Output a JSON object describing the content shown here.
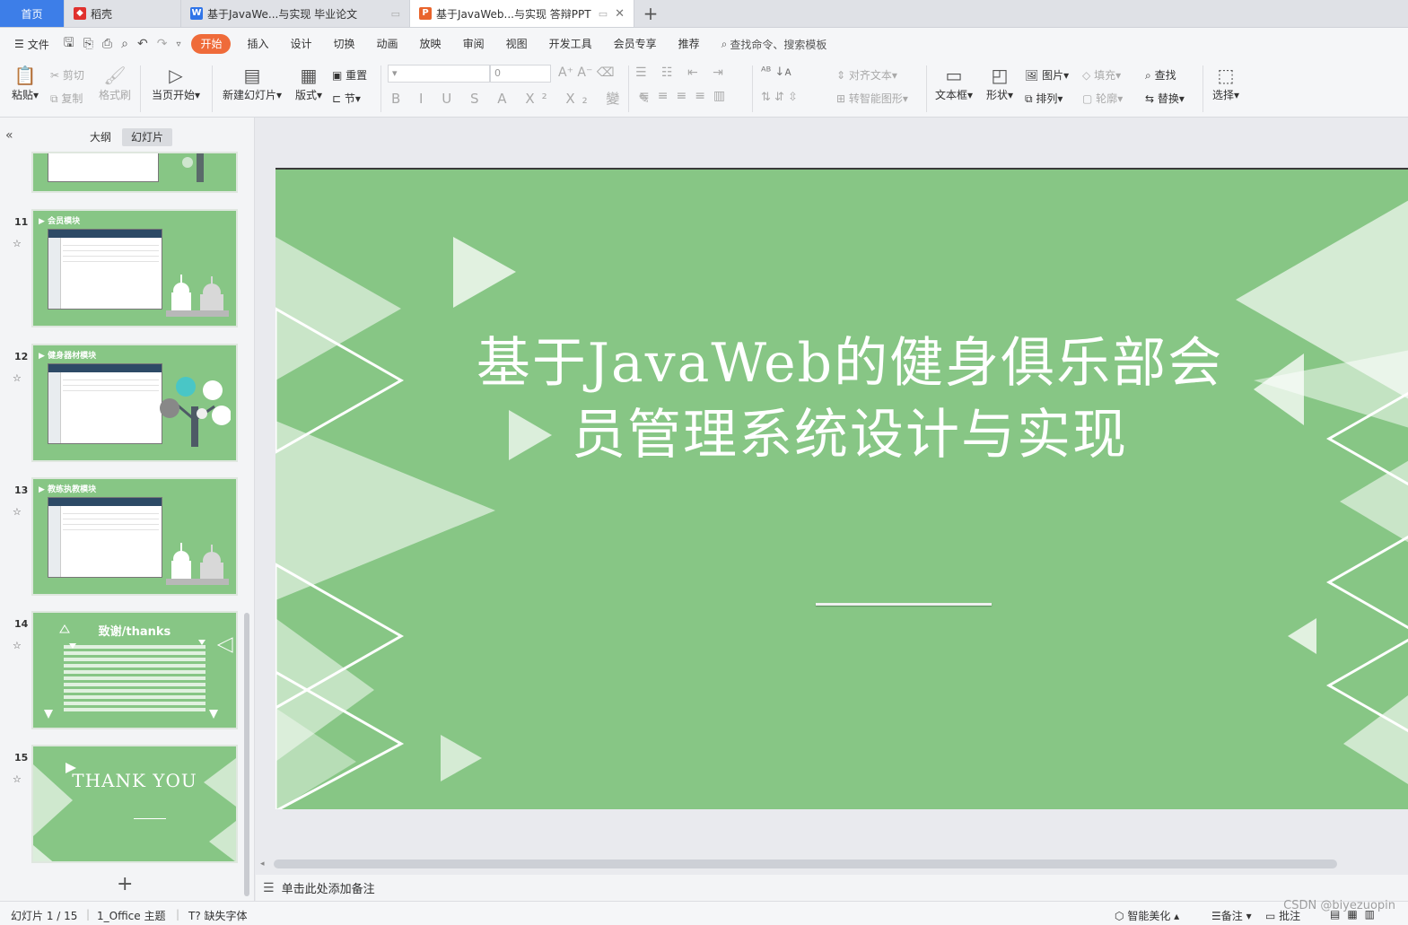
{
  "tabs": [
    {
      "label": "首页"
    },
    {
      "label": "稻壳",
      "icon": "docer-icon"
    },
    {
      "label": "基于JavaWe...与实现 毕业论文",
      "icon": "wps-writer-icon"
    },
    {
      "label": "基于JavaWeb...与实现 答辩PPT",
      "icon": "wps-presentation-icon"
    }
  ],
  "menu": {
    "file": "文件",
    "items": [
      "开始",
      "插入",
      "设计",
      "切换",
      "动画",
      "放映",
      "审阅",
      "视图",
      "开发工具",
      "会员专享",
      "推荐"
    ],
    "active": "开始",
    "search": "查找命令、搜索模板"
  },
  "ribbon": {
    "paste": "粘贴",
    "cut": "剪切",
    "copy": "复制",
    "format_painter": "格式刷",
    "from_current": "当页开始",
    "new_slide": "新建幻灯片",
    "layout": "版式",
    "reset": "重置",
    "section": "节",
    "font_size": "0",
    "align_text": "对齐文本",
    "smartart": "转智能图形",
    "textbox": "文本框",
    "shape": "形状",
    "picture": "图片",
    "arrange": "排列",
    "fill": "填充",
    "outline": "轮廓",
    "find": "查找",
    "replace": "替换",
    "select": "选择"
  },
  "left_panel": {
    "view_outline": "大纲",
    "view_slides": "幻灯片",
    "slides": [
      {
        "num": "11",
        "title": "会员模块"
      },
      {
        "num": "12",
        "title": "健身器材模块"
      },
      {
        "num": "13",
        "title": "教练执教模块"
      },
      {
        "num": "14",
        "title": "致谢/thanks"
      },
      {
        "num": "15",
        "title": "THANK YOU"
      }
    ]
  },
  "slide": {
    "title_line1": "基于JavaWeb的健身俱乐部会",
    "title_line2": "员管理系统设计与实现",
    "background": "#87c685"
  },
  "notes_placeholder": "单击此处添加备注",
  "status": {
    "slide_counter": "幻灯片 1 / 15",
    "theme": "1_Office 主题",
    "missing_fonts": "缺失字体",
    "smart_beautify": "智能美化",
    "notes": "备注",
    "comments": "批注"
  },
  "watermark": "CSDN @biyezuopin",
  "colors": {
    "accent": "#ef6b3a",
    "home_tab": "#3d7ee8",
    "slide_green": "#87c685"
  }
}
